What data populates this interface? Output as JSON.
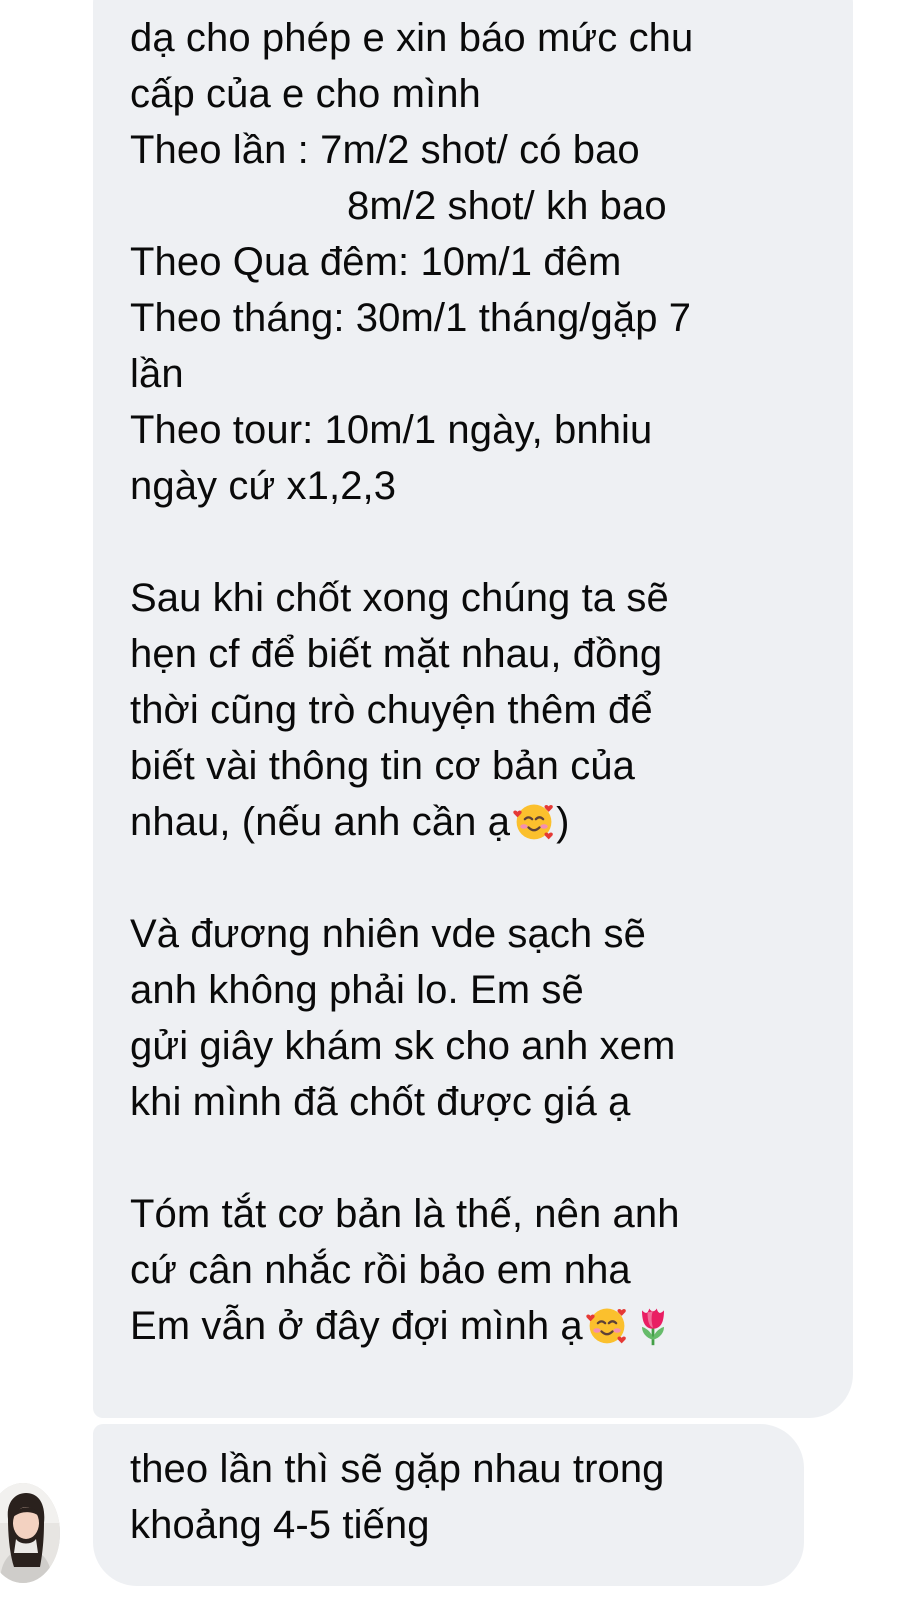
{
  "messages": [
    {
      "lines": [
        "dạ cho phép e xin báo mức chu",
        "cấp của e cho mình",
        "Theo lần : 7m/2 shot/ có bao",
        "8m/2 shot/ kh bao",
        "Theo Qua đêm: 10m/1 đêm",
        "Theo tháng: 30m/1 tháng/gặp 7",
        "lần",
        "Theo tour: 10m/1 ngày, bnhiu",
        "ngày cứ x1,2,3",
        "Sau khi chốt xong chúng ta sẽ",
        "hẹn cf để biết mặt nhau, đồng",
        "thời cũng trò chuyện thêm để",
        "biết vài thông tin cơ bản của",
        "nhau, (nếu anh cần ạ",
        ")",
        "Và đương nhiên vde sạch sẽ",
        "anh không phải lo. Em sẽ",
        "gửi giây khám sk cho anh xem",
        "khi mình đã chốt được giá ạ",
        "Tóm tắt cơ bản là thế, nên anh",
        "cứ cân nhắc rồi bảo em nha",
        "Em vẫn ở đây đợi mình ạ"
      ]
    },
    {
      "lines": [
        "theo lần thì sẽ gặp nhau trong",
        "khoảng 4-5 tiếng"
      ]
    }
  ],
  "icons": {
    "smiling_face_with_hearts": "smiling-face-with-hearts-icon",
    "tulip": "tulip-icon"
  },
  "colors": {
    "bubble_background": "#eef0f3",
    "text": "#0a0a0a"
  }
}
